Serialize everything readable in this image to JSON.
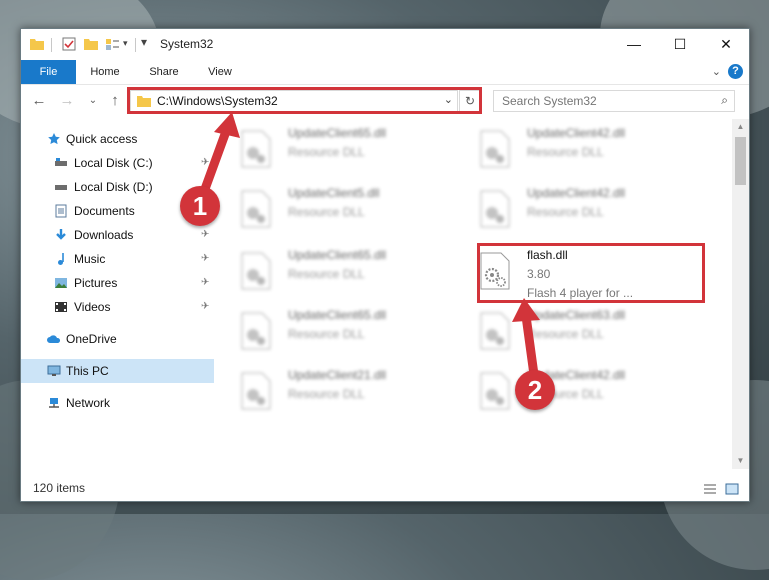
{
  "window": {
    "title": "System32",
    "minimize": "—",
    "maximize": "☐",
    "close": "✕"
  },
  "ribbon": {
    "tabs": [
      "File",
      "Home",
      "Share",
      "View"
    ],
    "help": "?"
  },
  "navigation": {
    "back": "←",
    "forward": "→",
    "recent": "⌄",
    "up": "↑",
    "address": "C:\\Windows\\System32",
    "refresh": "↻",
    "search_placeholder": "Search System32"
  },
  "sidebar": {
    "items": [
      {
        "label": "Quick access",
        "icon": "star-icon"
      },
      {
        "label": "Local Disk (C:)",
        "icon": "drive-icon",
        "pinned": true
      },
      {
        "label": "Local Disk (D:)",
        "icon": "drive-icon"
      },
      {
        "label": "Documents",
        "icon": "document-icon"
      },
      {
        "label": "Downloads",
        "icon": "download-icon",
        "pinned": true
      },
      {
        "label": "Music",
        "icon": "music-icon",
        "pinned": true
      },
      {
        "label": "Pictures",
        "icon": "picture-icon",
        "pinned": true
      },
      {
        "label": "Videos",
        "icon": "video-icon",
        "pinned": true
      },
      {
        "label": "OneDrive",
        "icon": "cloud-icon"
      },
      {
        "label": "This PC",
        "icon": "computer-icon",
        "selected": true
      },
      {
        "label": "Network",
        "icon": "network-icon"
      }
    ]
  },
  "files": [
    {
      "name": "UpdateClient65.dll",
      "sub": "Resource DLL",
      "blurred": true
    },
    {
      "name": "UpdateClient42.dll",
      "sub": "Resource DLL",
      "blurred": true
    },
    {
      "name": "UpdateClient5.dll",
      "sub": "Resource DLL",
      "blurred": true
    },
    {
      "name": "UpdateClient42.dll",
      "sub": "Resource DLL",
      "blurred": true
    },
    {
      "name": "UpdateClient65.dll",
      "sub": "Resource DLL",
      "blurred": true
    },
    {
      "name": "flash.dll",
      "sub": "3.80",
      "sub2": "Flash 4 player for ...",
      "blurred": false
    },
    {
      "name": "UpdateClient65.dll",
      "sub": "Resource DLL",
      "blurred": true
    },
    {
      "name": "UpdateClient63.dll",
      "sub": "Resource DLL",
      "blurred": true
    },
    {
      "name": "UpdateClient21.dll",
      "sub": "Resource DLL",
      "blurred": true
    },
    {
      "name": "UpdateClient42.dll",
      "sub": "Resource DLL",
      "blurred": true
    }
  ],
  "status": {
    "item_count": "120 items"
  },
  "callouts": [
    "1",
    "2"
  ],
  "colors": {
    "accent": "#1979ca",
    "highlight": "#d2343a",
    "selected": "#cce4f7"
  }
}
